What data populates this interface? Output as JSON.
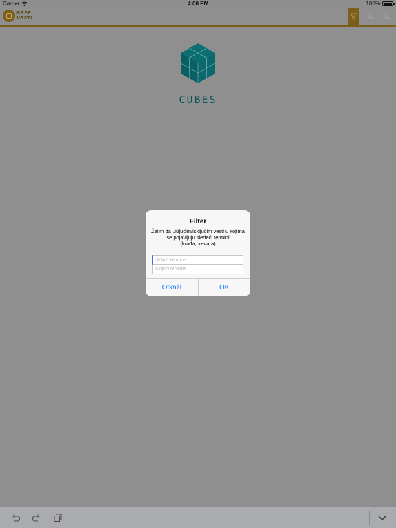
{
  "status_bar": {
    "carrier": "Carrier",
    "time": "4:08 PM",
    "battery": "100%"
  },
  "header": {
    "logo_line1": "BRZE",
    "logo_line2": "VESTI",
    "icons": [
      "filter-icon",
      "phone-icon",
      "search-icon"
    ]
  },
  "brand": {
    "name": "CUBES",
    "color": "#0f7b80"
  },
  "alert": {
    "title": "Filter",
    "message": "Želim da uključim/isključim vesti u kojima se pojavljuju sledeći termini (krađa,prevara)",
    "include_placeholder": "Uključi termine",
    "exclude_placeholder": "Isključi termine",
    "cancel_label": "Otkaži",
    "ok_label": "OK"
  },
  "toolbar": {
    "icons": [
      "undo-icon",
      "redo-icon",
      "clipboard-icon",
      "keyboard-dismiss-icon"
    ]
  },
  "colors": {
    "accent": "#7a5f1a",
    "link": "#147efb",
    "dim_overlay": "#8f8f8f"
  }
}
